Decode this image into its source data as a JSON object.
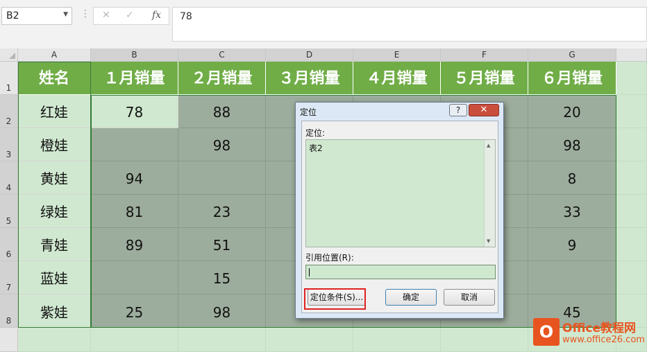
{
  "formula_bar": {
    "name_box": "B2",
    "cancel_icon": "✕",
    "enter_icon": "✓",
    "fx_label": "fx",
    "content": "78"
  },
  "columns": [
    "A",
    "B",
    "C",
    "D",
    "E",
    "F",
    "G"
  ],
  "rows": [
    "1",
    "2",
    "3",
    "4",
    "5",
    "6",
    "7",
    "8"
  ],
  "table": {
    "headers": [
      "姓名",
      "１月销量",
      "２月销量",
      "３月销量",
      "４月销量",
      "５月销量",
      "６月销量"
    ],
    "rows": [
      [
        "红娃",
        "78",
        "88",
        "",
        "",
        "",
        "20"
      ],
      [
        "橙娃",
        "",
        "98",
        "",
        "",
        "",
        "98"
      ],
      [
        "黄娃",
        "94",
        "",
        "",
        "",
        "",
        "8"
      ],
      [
        "绿娃",
        "81",
        "23",
        "",
        "",
        "",
        "33"
      ],
      [
        "青娃",
        "89",
        "51",
        "",
        "",
        "",
        "9"
      ],
      [
        "蓝娃",
        "",
        "15",
        "",
        "",
        "",
        ""
      ],
      [
        "紫娃",
        "25",
        "98",
        "",
        "",
        "",
        "45"
      ]
    ]
  },
  "dialog": {
    "title": "定位",
    "help_label": "?",
    "close_label": "✕",
    "goto_label": "定位:",
    "list_items": [
      "表2"
    ],
    "reference_label": "引用位置(R):",
    "reference_value": "",
    "special_button": "定位条件(S)...",
    "ok_button": "确定",
    "cancel_button": "取消"
  },
  "watermark": {
    "logo_text": "O",
    "line1": "Office教程网",
    "line2": "www.office26.com"
  },
  "colors": {
    "header_green": "#70ad47",
    "selected_cell": "#9dad9d",
    "light_green": "#d0e8d0",
    "highlight_red": "#e02020",
    "brand_orange": "#e8541f"
  }
}
